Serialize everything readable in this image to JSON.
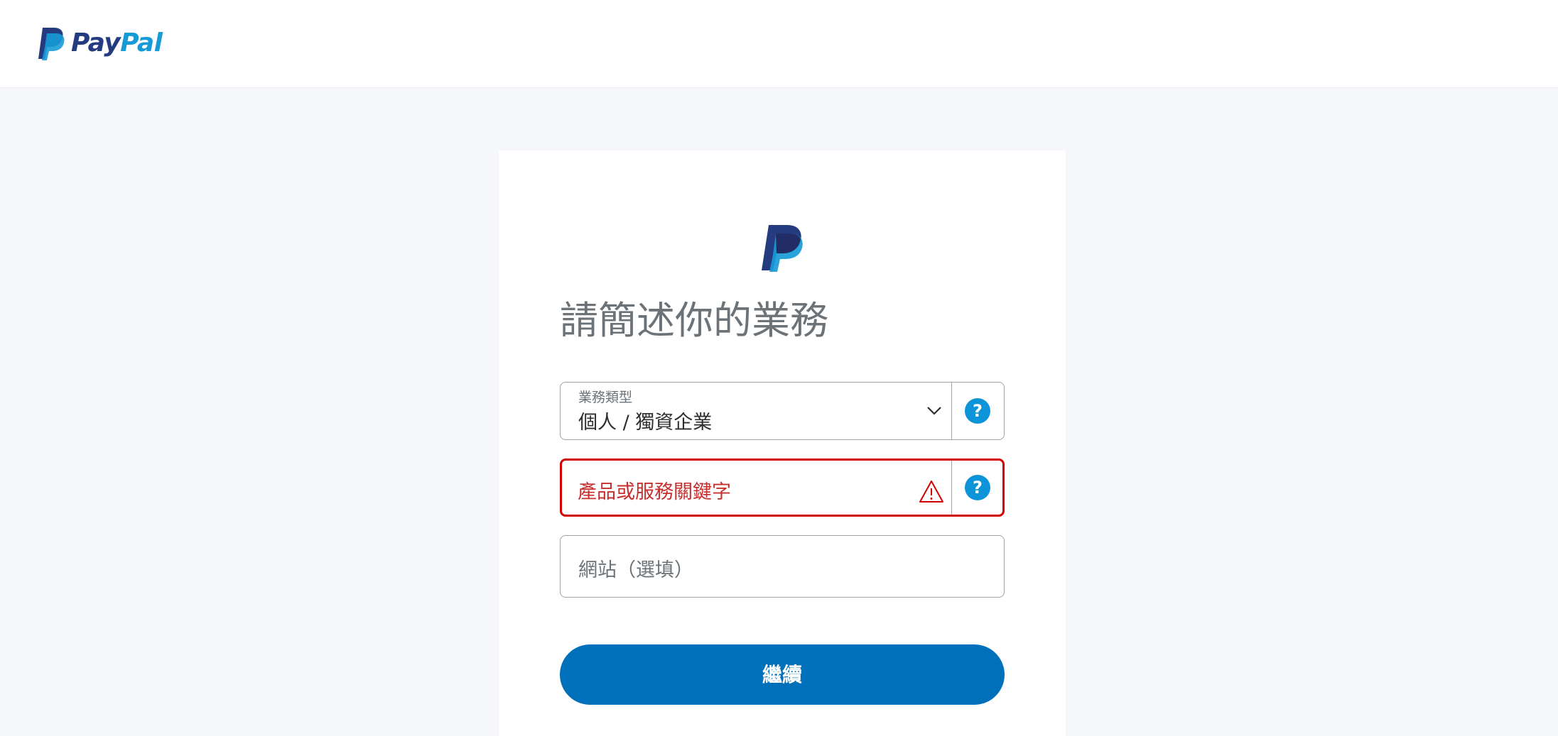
{
  "header": {
    "logo_text_pay": "Pay",
    "logo_text_pal": "Pal"
  },
  "form": {
    "title": "請簡述你的業務",
    "business_type": {
      "label": "業務類型",
      "value": "個人 / 獨資企業",
      "help": "?"
    },
    "keywords": {
      "placeholder": "產品或服務關鍵字",
      "state": "error",
      "help": "?"
    },
    "website": {
      "placeholder": "網站（選填）"
    },
    "continue_label": "繼續"
  },
  "colors": {
    "brand_dark": "#253b80",
    "brand_light": "#179bd7",
    "button": "#0070ba",
    "error": "#d20000",
    "help_icon": "#0d94d8"
  },
  "icons": {
    "business_type_help": "question-circle-icon",
    "keywords_help": "question-circle-icon",
    "keywords_error": "warning-triangle-icon",
    "dropdown": "chevron-down-icon"
  }
}
